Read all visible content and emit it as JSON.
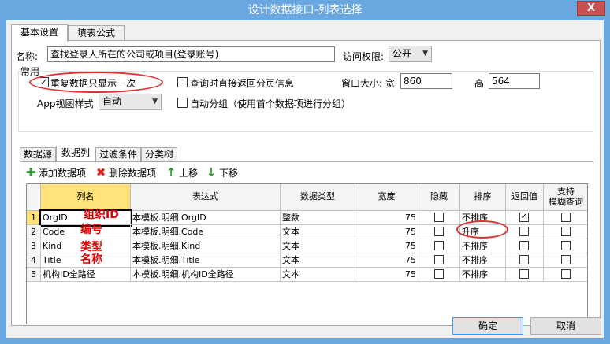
{
  "window": {
    "title": "设计数据接口-列表选择",
    "close_label": "X"
  },
  "tabs": [
    {
      "label": "基本设置"
    },
    {
      "label": "填表公式"
    }
  ],
  "form": {
    "name_label": "名称:",
    "name_value": "查找登录人所在的公司或项目(登录账号)",
    "access_label": "访问权限:",
    "access_value": "公开",
    "group_title": "常用",
    "dedupe_label": "重复数据只显示一次",
    "dedupe_checked": true,
    "direct_page_label": "查询时直接返回分页信息",
    "direct_page_checked": false,
    "window_size_label": "窗口大小: 宽",
    "width_value": "860",
    "height_label": "高",
    "height_value": "564",
    "app_view_label": "App视图样式",
    "app_view_value": "自动",
    "auto_group_label": "自动分组（使用首个数据项进行分组）",
    "auto_group_checked": false
  },
  "inner_tabs": [
    {
      "label": "数据源"
    },
    {
      "label": "数据列"
    },
    {
      "label": "过滤条件"
    },
    {
      "label": "分类树"
    }
  ],
  "toolbar": {
    "add_label": "添加数据项",
    "delete_label": "删除数据项",
    "up_label": "上移",
    "down_label": "下移"
  },
  "grid": {
    "headers": {
      "name": "列名",
      "expr": "表达式",
      "type": "数据类型",
      "width": "宽度",
      "hidden": "隐藏",
      "sort": "排序",
      "return": "返回值",
      "fuzzy_line1": "支持",
      "fuzzy_line2": "模糊查询"
    },
    "rows": [
      {
        "num": "1",
        "name": "OrgID",
        "expr": "本模板.明细.OrgID",
        "type": "整数",
        "width": "75",
        "hidden": false,
        "sort": "不排序",
        "return": true,
        "fuzzy": false
      },
      {
        "num": "2",
        "name": "Code",
        "expr": "本模板.明细.Code",
        "type": "文本",
        "width": "75",
        "hidden": false,
        "sort": "升序",
        "return": false,
        "fuzzy": false
      },
      {
        "num": "3",
        "name": "Kind",
        "expr": "本模板.明细.Kind",
        "type": "文本",
        "width": "75",
        "hidden": false,
        "sort": "不排序",
        "return": false,
        "fuzzy": false
      },
      {
        "num": "4",
        "name": "Title",
        "expr": "本模板.明细.Title",
        "type": "文本",
        "width": "75",
        "hidden": false,
        "sort": "不排序",
        "return": false,
        "fuzzy": false
      },
      {
        "num": "5",
        "name": "机构ID全路径",
        "expr": "本模板.明细.机构ID全路径",
        "type": "文本",
        "width": "75",
        "hidden": false,
        "sort": "不排序",
        "return": false,
        "fuzzy": false
      }
    ]
  },
  "annotations": {
    "a1": "组织ID",
    "a2": "编号",
    "a3": "类型",
    "a4": "名称"
  },
  "buttons": {
    "ok_label": "确定",
    "cancel_label": "取消"
  },
  "check_mark": "✓"
}
